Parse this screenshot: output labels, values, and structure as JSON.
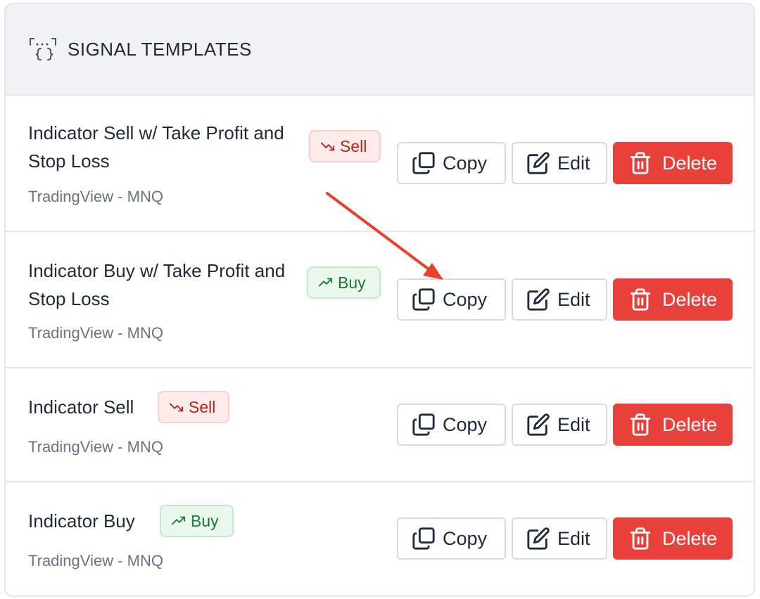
{
  "header": {
    "title": "SIGNAL TEMPLATES",
    "icon": "code-braces-icon"
  },
  "templates": [
    {
      "title": "Indicator Sell w/ Take Profit and Stop Loss",
      "source": "TradingView - MNQ",
      "badge": "Sell",
      "badge_type": "sell"
    },
    {
      "title": "Indicator Buy w/ Take Profit and Stop Loss",
      "source": "TradingView - MNQ",
      "badge": "Buy",
      "badge_type": "buy"
    },
    {
      "title": "Indicator Sell",
      "source": "TradingView - MNQ",
      "badge": "Sell",
      "badge_type": "sell"
    },
    {
      "title": "Indicator Buy",
      "source": "TradingView - MNQ",
      "badge": "Buy",
      "badge_type": "buy"
    }
  ],
  "actions": {
    "copy_label": "Copy",
    "edit_label": "Edit",
    "delete_label": "Delete"
  },
  "colors": {
    "delete": "#e8403a",
    "sell": "#b3261e",
    "buy": "#1f7a34",
    "annotation_arrow": "#e8402a"
  },
  "annotation": {
    "type": "arrow",
    "icon": "arrow-annotation",
    "points_to": "copy-button of template 2"
  }
}
